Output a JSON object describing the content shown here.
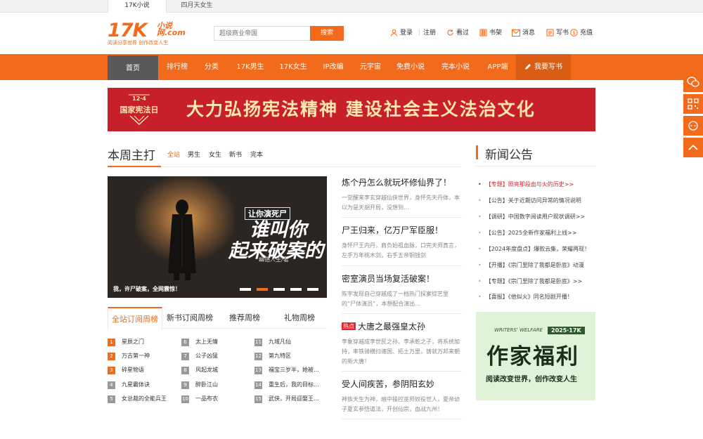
{
  "top_tabs": [
    "17K小说",
    "四月天女生"
  ],
  "logo": {
    "main": "17K",
    "site": "小说网.com",
    "slogan": "阅读分享世界 创作改变人生"
  },
  "search": {
    "placeholder": "超级商业帝国",
    "button": "搜索"
  },
  "header_links": {
    "login": "登录",
    "register": "注册",
    "history": "看过",
    "shelf": "书架",
    "messages": "消息",
    "write": "写书",
    "recharge": "充值"
  },
  "nav": [
    "首页",
    "排行榜",
    "分类",
    "17K男生",
    "17K女生",
    "IP改编",
    "元宇宙",
    "免费小说",
    "完本小说",
    "APP端",
    "我要写书"
  ],
  "banner": {
    "badge_date": "12·4",
    "badge_text": "国家宪法日",
    "slogan": "大力弘扬宪法精神  建设社会主义法治文化"
  },
  "weekly": {
    "title": "本周主打",
    "filters": [
      "全站",
      "男生",
      "女生",
      "新书",
      "完本"
    ],
    "feature": {
      "tag": "让你演死尸",
      "title_line1": "谁叫你",
      "title_line2": "起来破案的",
      "author": "幽铬人生/著",
      "caption": "我，许尸破案，全网震惊！"
    },
    "stories": [
      {
        "title": "炼个丹怎么就玩坏修仙界了！",
        "desc": "一觉醒来李玄穿越仙侠世界，身怀先天丹体，本以为是天胡开局，没想到...",
        "hot": ""
      },
      {
        "title": "尸王归来，亿万尸军臣服！",
        "desc": "身怀尸王内丹，肩负始祖血脉，口完天师真言，左手万年桃木剑，右手五帝铜钱剑",
        "hot": ""
      },
      {
        "title": "密室演员当场复活破案！",
        "desc": "陈宇发现自己穿越成了一档热门探案综艺里的“尸体演员”，本想配合演出...",
        "hot": ""
      },
      {
        "title": "大唐之最强皇太孙",
        "desc": "李象穿越成李世民之孙、李承乾之子，将系统加持，率铁骑横扫诸国、拓土万里，铸就万邦来朝的新大唐！",
        "hot": "热点"
      },
      {
        "title": "受人间疾苦，参阴阳玄妙",
        "desc": "神族天生为神，暗中操控巫师奴役世人，夏帝幼子夏玄参悟道法，开创仙宗，血战九州！",
        "hot": ""
      }
    ]
  },
  "rankings": {
    "tabs": [
      "全站订阅周榜",
      "新书订阅周榜",
      "推荐周榜",
      "礼物周榜"
    ],
    "items": [
      {
        "rank": "1",
        "title": "星辰之门"
      },
      {
        "rank": "2",
        "title": "万古第一神"
      },
      {
        "rank": "3",
        "title": "碎星物语"
      },
      {
        "rank": "4",
        "title": "九星霸体诀"
      },
      {
        "rank": "5",
        "title": "女总裁的全能兵王"
      },
      {
        "rank": "6",
        "title": "太上无情"
      },
      {
        "rank": "7",
        "title": "公子凶猛"
      },
      {
        "rank": "8",
        "title": "风起龙城"
      },
      {
        "rank": "9",
        "title": "醉卧江山"
      },
      {
        "rank": "10",
        "title": "一品布衣"
      },
      {
        "rank": "11",
        "title": "九域凡仙"
      },
      {
        "rank": "12",
        "title": "第九特区"
      },
      {
        "rank": "13",
        "title": "福宝三岁半，她被..."
      },
      {
        "rank": "14",
        "title": "重生后，我的目标..."
      },
      {
        "rank": "15",
        "title": "武侠，开局迎娶王..."
      }
    ]
  },
  "news": {
    "title": "新闻公告",
    "items": [
      {
        "text": "【专题】照亮那段血与火的历史>>",
        "red": true
      },
      {
        "text": "【公告】关于近期访问异常的情况说明",
        "red": false
      },
      {
        "text": "【调研】中国数字阅读用户现状调研>>",
        "red": false
      },
      {
        "text": "【公告】2025全新作家福利上线>>",
        "red": false
      },
      {
        "text": "【2024年度盘点】爆款云集，荣耀再现！",
        "red": false
      },
      {
        "text": "【开播】《宗门里除了我都是卧底》动漫",
        "red": false
      },
      {
        "text": "【专题】《宗门里除了我都是卧底》>>",
        "red": false
      },
      {
        "text": "【喜报】《他似火》同名短剧开播！",
        "red": false
      }
    ]
  },
  "welfare": {
    "tag": "WRITERS' WELFARE",
    "year": "2025·17K",
    "title": "作家福利",
    "slogan": "阅读改变世界，创作改变人生"
  },
  "colors": {
    "accent": "#f26b1d",
    "banner_red": "#c8202a",
    "nav_home": "#595959"
  }
}
